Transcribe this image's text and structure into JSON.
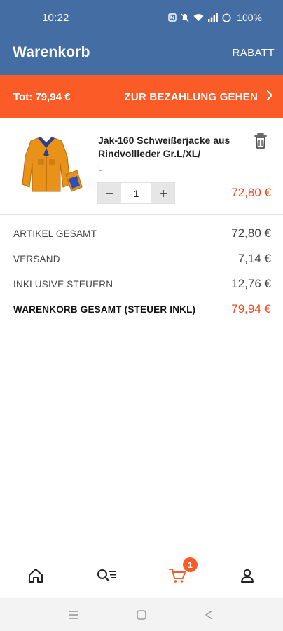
{
  "status_bar": {
    "time": "10:22",
    "battery": "100%"
  },
  "header": {
    "title": "Warenkorb",
    "rabatt_label": "RABATT"
  },
  "checkout_bar": {
    "total_text": "Tot: 79,94 €",
    "button_label": "ZUR BEZAHLUNG GEHEN"
  },
  "cart": {
    "items": [
      {
        "name": "Jak-160 Schweißerjacke aus Rindvollleder Gr.L/XL/",
        "variant": "L",
        "quantity": "1",
        "price": "72,80 €"
      }
    ]
  },
  "summary": {
    "rows": [
      {
        "label": "ARTIKEL GESAMT",
        "value": "72,80 €"
      },
      {
        "label": "VERSAND",
        "value": "7,14 €"
      },
      {
        "label": "INKLUSIVE STEUERN",
        "value": "12,76 €"
      },
      {
        "label": "WARENKORB GESAMT (STEUER INKL)",
        "value": "79,94 €"
      }
    ]
  },
  "bottom_nav": {
    "cart_badge": "1",
    "items": [
      "home-icon",
      "search-icon",
      "cart-icon",
      "account-icon"
    ]
  },
  "colors": {
    "header_blue": "#446da3",
    "accent_orange": "#fa5b27",
    "price_red": "#ee4a1c"
  }
}
